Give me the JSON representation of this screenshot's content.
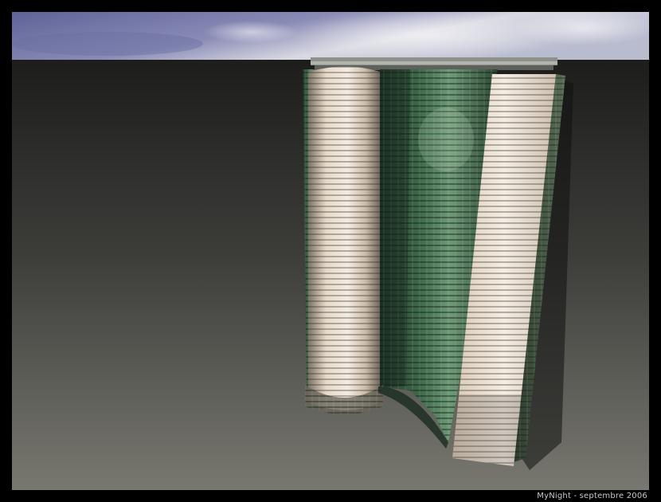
{
  "caption": "MyNight - septembre 2006",
  "colors": {
    "border": "#000000",
    "sky_top": "#7a7fb0",
    "sky_bottom": "#dcdde6",
    "ground_top": "#262624",
    "ground_bottom": "#6f6f68",
    "glass": "#3b5a44",
    "cladding": "#e9ddcf"
  }
}
